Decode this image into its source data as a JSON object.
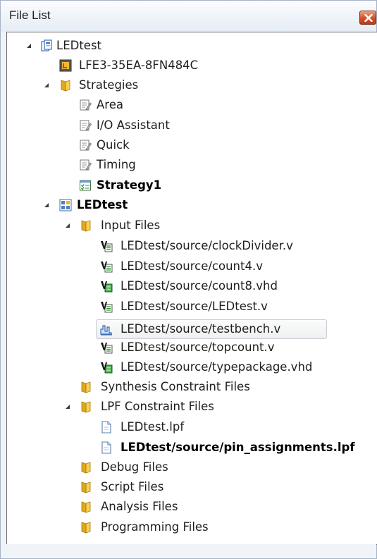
{
  "panel": {
    "title": "File List",
    "close_label": "Close"
  },
  "tree": {
    "project": "LEDtest",
    "device": "LFE3-35EA-8FN484C",
    "strategies_folder": "Strategies",
    "strategies": [
      "Area",
      "I/O Assistant",
      "Quick",
      "Timing",
      "Strategy1"
    ],
    "implementation": "LEDtest",
    "input_files_folder": "Input Files",
    "input_files": [
      "LEDtest/source/clockDivider.v",
      "LEDtest/source/count4.v",
      "LEDtest/source/count8.vhd",
      "LEDtest/source/LEDtest.v",
      "LEDtest/source/testbench.v",
      "LEDtest/source/topcount.v",
      "LEDtest/source/typepackage.vhd"
    ],
    "synthesis_folder": "Synthesis Constraint Files",
    "lpf_folder": "LPF Constraint Files",
    "lpf_files": [
      "LEDtest.lpf",
      "LEDtest/source/pin_assignments.lpf"
    ],
    "debug_folder": "Debug Files",
    "script_folder": "Script Files",
    "analysis_folder": "Analysis Files",
    "programming_folder": "Programming Files"
  }
}
